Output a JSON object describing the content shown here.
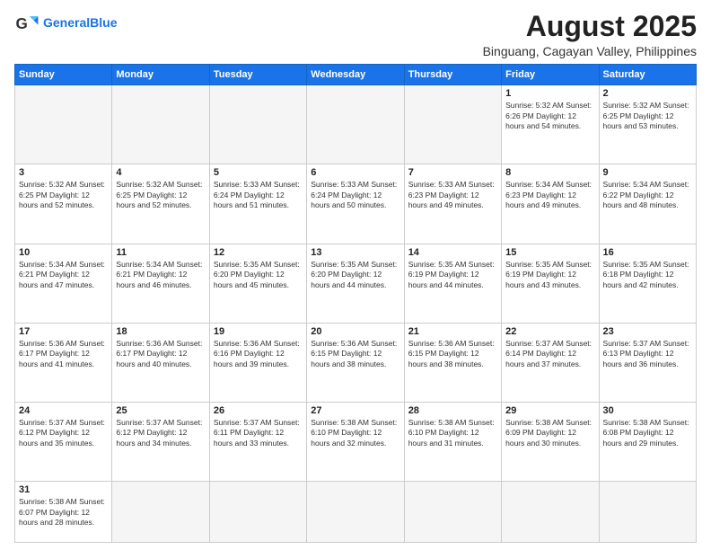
{
  "header": {
    "logo_general": "General",
    "logo_blue": "Blue",
    "month_title": "August 2025",
    "location": "Binguang, Cagayan Valley, Philippines"
  },
  "weekdays": [
    "Sunday",
    "Monday",
    "Tuesday",
    "Wednesday",
    "Thursday",
    "Friday",
    "Saturday"
  ],
  "weeks": [
    [
      {
        "day": "",
        "info": ""
      },
      {
        "day": "",
        "info": ""
      },
      {
        "day": "",
        "info": ""
      },
      {
        "day": "",
        "info": ""
      },
      {
        "day": "",
        "info": ""
      },
      {
        "day": "1",
        "info": "Sunrise: 5:32 AM\nSunset: 6:26 PM\nDaylight: 12 hours\nand 54 minutes."
      },
      {
        "day": "2",
        "info": "Sunrise: 5:32 AM\nSunset: 6:25 PM\nDaylight: 12 hours\nand 53 minutes."
      }
    ],
    [
      {
        "day": "3",
        "info": "Sunrise: 5:32 AM\nSunset: 6:25 PM\nDaylight: 12 hours\nand 52 minutes."
      },
      {
        "day": "4",
        "info": "Sunrise: 5:32 AM\nSunset: 6:25 PM\nDaylight: 12 hours\nand 52 minutes."
      },
      {
        "day": "5",
        "info": "Sunrise: 5:33 AM\nSunset: 6:24 PM\nDaylight: 12 hours\nand 51 minutes."
      },
      {
        "day": "6",
        "info": "Sunrise: 5:33 AM\nSunset: 6:24 PM\nDaylight: 12 hours\nand 50 minutes."
      },
      {
        "day": "7",
        "info": "Sunrise: 5:33 AM\nSunset: 6:23 PM\nDaylight: 12 hours\nand 49 minutes."
      },
      {
        "day": "8",
        "info": "Sunrise: 5:34 AM\nSunset: 6:23 PM\nDaylight: 12 hours\nand 49 minutes."
      },
      {
        "day": "9",
        "info": "Sunrise: 5:34 AM\nSunset: 6:22 PM\nDaylight: 12 hours\nand 48 minutes."
      }
    ],
    [
      {
        "day": "10",
        "info": "Sunrise: 5:34 AM\nSunset: 6:21 PM\nDaylight: 12 hours\nand 47 minutes."
      },
      {
        "day": "11",
        "info": "Sunrise: 5:34 AM\nSunset: 6:21 PM\nDaylight: 12 hours\nand 46 minutes."
      },
      {
        "day": "12",
        "info": "Sunrise: 5:35 AM\nSunset: 6:20 PM\nDaylight: 12 hours\nand 45 minutes."
      },
      {
        "day": "13",
        "info": "Sunrise: 5:35 AM\nSunset: 6:20 PM\nDaylight: 12 hours\nand 44 minutes."
      },
      {
        "day": "14",
        "info": "Sunrise: 5:35 AM\nSunset: 6:19 PM\nDaylight: 12 hours\nand 44 minutes."
      },
      {
        "day": "15",
        "info": "Sunrise: 5:35 AM\nSunset: 6:19 PM\nDaylight: 12 hours\nand 43 minutes."
      },
      {
        "day": "16",
        "info": "Sunrise: 5:35 AM\nSunset: 6:18 PM\nDaylight: 12 hours\nand 42 minutes."
      }
    ],
    [
      {
        "day": "17",
        "info": "Sunrise: 5:36 AM\nSunset: 6:17 PM\nDaylight: 12 hours\nand 41 minutes."
      },
      {
        "day": "18",
        "info": "Sunrise: 5:36 AM\nSunset: 6:17 PM\nDaylight: 12 hours\nand 40 minutes."
      },
      {
        "day": "19",
        "info": "Sunrise: 5:36 AM\nSunset: 6:16 PM\nDaylight: 12 hours\nand 39 minutes."
      },
      {
        "day": "20",
        "info": "Sunrise: 5:36 AM\nSunset: 6:15 PM\nDaylight: 12 hours\nand 38 minutes."
      },
      {
        "day": "21",
        "info": "Sunrise: 5:36 AM\nSunset: 6:15 PM\nDaylight: 12 hours\nand 38 minutes."
      },
      {
        "day": "22",
        "info": "Sunrise: 5:37 AM\nSunset: 6:14 PM\nDaylight: 12 hours\nand 37 minutes."
      },
      {
        "day": "23",
        "info": "Sunrise: 5:37 AM\nSunset: 6:13 PM\nDaylight: 12 hours\nand 36 minutes."
      }
    ],
    [
      {
        "day": "24",
        "info": "Sunrise: 5:37 AM\nSunset: 6:12 PM\nDaylight: 12 hours\nand 35 minutes."
      },
      {
        "day": "25",
        "info": "Sunrise: 5:37 AM\nSunset: 6:12 PM\nDaylight: 12 hours\nand 34 minutes."
      },
      {
        "day": "26",
        "info": "Sunrise: 5:37 AM\nSunset: 6:11 PM\nDaylight: 12 hours\nand 33 minutes."
      },
      {
        "day": "27",
        "info": "Sunrise: 5:38 AM\nSunset: 6:10 PM\nDaylight: 12 hours\nand 32 minutes."
      },
      {
        "day": "28",
        "info": "Sunrise: 5:38 AM\nSunset: 6:10 PM\nDaylight: 12 hours\nand 31 minutes."
      },
      {
        "day": "29",
        "info": "Sunrise: 5:38 AM\nSunset: 6:09 PM\nDaylight: 12 hours\nand 30 minutes."
      },
      {
        "day": "30",
        "info": "Sunrise: 5:38 AM\nSunset: 6:08 PM\nDaylight: 12 hours\nand 29 minutes."
      }
    ],
    [
      {
        "day": "31",
        "info": "Sunrise: 5:38 AM\nSunset: 6:07 PM\nDaylight: 12 hours\nand 28 minutes."
      },
      {
        "day": "",
        "info": ""
      },
      {
        "day": "",
        "info": ""
      },
      {
        "day": "",
        "info": ""
      },
      {
        "day": "",
        "info": ""
      },
      {
        "day": "",
        "info": ""
      },
      {
        "day": "",
        "info": ""
      }
    ]
  ]
}
